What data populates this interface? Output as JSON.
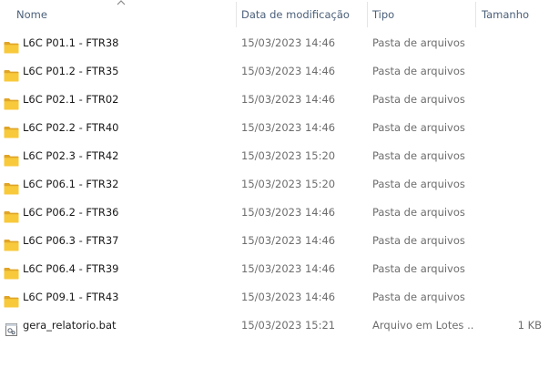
{
  "columns": {
    "name": "Nome",
    "date": "Data de modificação",
    "type": "Tipo",
    "size": "Tamanho"
  },
  "sort": {
    "column": "name",
    "direction": "ascending"
  },
  "files": [
    {
      "name": "L6C P01.1 - FTR38",
      "date": "15/03/2023 14:46",
      "type": "Pasta de arquivos",
      "size": "",
      "icon": "folder-icon"
    },
    {
      "name": "L6C P01.2 - FTR35",
      "date": "15/03/2023 14:46",
      "type": "Pasta de arquivos",
      "size": "",
      "icon": "folder-icon"
    },
    {
      "name": "L6C P02.1 - FTR02",
      "date": "15/03/2023 14:46",
      "type": "Pasta de arquivos",
      "size": "",
      "icon": "folder-icon"
    },
    {
      "name": "L6C P02.2 - FTR40",
      "date": "15/03/2023 14:46",
      "type": "Pasta de arquivos",
      "size": "",
      "icon": "folder-icon"
    },
    {
      "name": "L6C P02.3 - FTR42",
      "date": "15/03/2023 15:20",
      "type": "Pasta de arquivos",
      "size": "",
      "icon": "folder-icon"
    },
    {
      "name": "L6C P06.1 - FTR32",
      "date": "15/03/2023 15:20",
      "type": "Pasta de arquivos",
      "size": "",
      "icon": "folder-icon"
    },
    {
      "name": "L6C P06.2 - FTR36",
      "date": "15/03/2023 14:46",
      "type": "Pasta de arquivos",
      "size": "",
      "icon": "folder-icon"
    },
    {
      "name": "L6C P06.3 - FTR37",
      "date": "15/03/2023 14:46",
      "type": "Pasta de arquivos",
      "size": "",
      "icon": "folder-icon"
    },
    {
      "name": "L6C P06.4 - FTR39",
      "date": "15/03/2023 14:46",
      "type": "Pasta de arquivos",
      "size": "",
      "icon": "folder-icon"
    },
    {
      "name": "L6C P09.1 - FTR43",
      "date": "15/03/2023 14:46",
      "type": "Pasta de arquivos",
      "size": "",
      "icon": "folder-icon"
    },
    {
      "name": "gera_relatorio.bat",
      "date": "15/03/2023 15:21",
      "type": "Arquivo em Lotes ...",
      "size": "1 KB",
      "icon": "batch-file-icon"
    }
  ],
  "colors": {
    "header_text": "#4c607a",
    "secondary_text": "#6d6d6d",
    "folder_yellow": "#f8c93a",
    "folder_dark": "#e0a526"
  }
}
